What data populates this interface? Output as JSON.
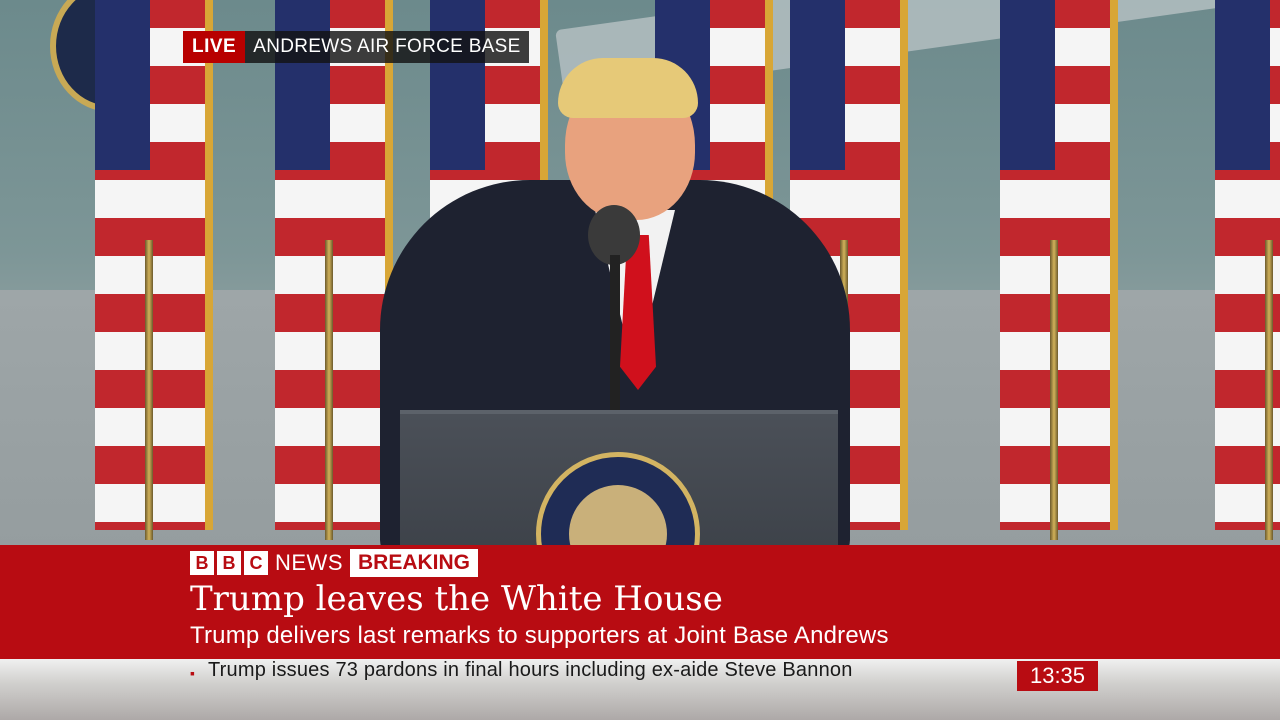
{
  "live_bug": {
    "live_label": "LIVE",
    "location": "ANDREWS AIR FORCE BASE"
  },
  "branding": {
    "bbc_letters": [
      "B",
      "B",
      "C"
    ],
    "news_label": "NEWS",
    "breaking_label": "BREAKING"
  },
  "story": {
    "headline": "Trump leaves the White House",
    "subheadline": "Trump delivers last remarks to supporters at Joint Base Andrews"
  },
  "ticker": {
    "bullet": "▪",
    "text": "Trump issues 73 pardons in final hours including ex-aide Steve Bannon"
  },
  "clock": {
    "time": "13:35"
  },
  "colors": {
    "bbc_red": "#b80c12",
    "live_red": "#b80000",
    "white": "#ffffff"
  }
}
